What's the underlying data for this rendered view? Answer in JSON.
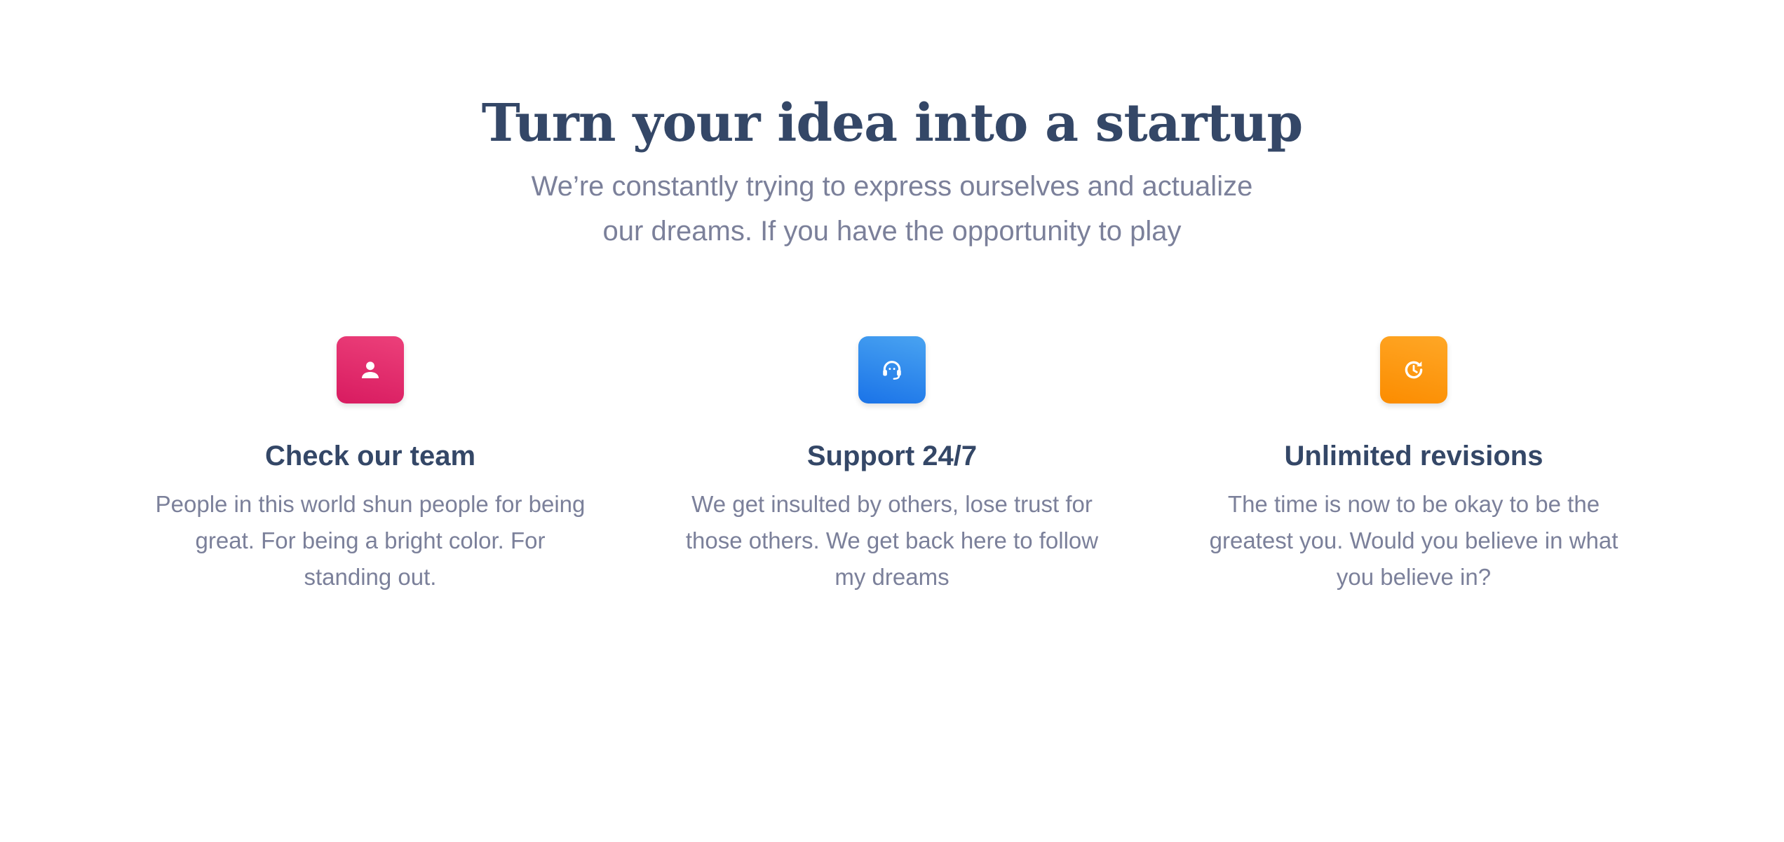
{
  "header": {
    "title": "Turn your idea into a startup",
    "subtitle": "We’re constantly trying to express ourselves and actualize our dreams. If you have the opportunity to play"
  },
  "features": [
    {
      "icon": "person-icon",
      "color": "#e91e63",
      "title": "Check our team",
      "description": "People in this world shun people for being great. For being a bright color. For standing out."
    },
    {
      "icon": "support-agent-icon",
      "color": "#1a73e8",
      "title": "Support 24/7",
      "description": "We get insulted by others, lose trust for those others. We get back here to follow my dreams"
    },
    {
      "icon": "update-icon",
      "color": "#fb8c00",
      "title": "Unlimited revisions",
      "description": "The time is now to be okay to be the greatest you. Would you believe in what you believe in?"
    }
  ],
  "colors": {
    "heading": "#344767",
    "body_text": "#7b809a",
    "background": "#ffffff"
  }
}
